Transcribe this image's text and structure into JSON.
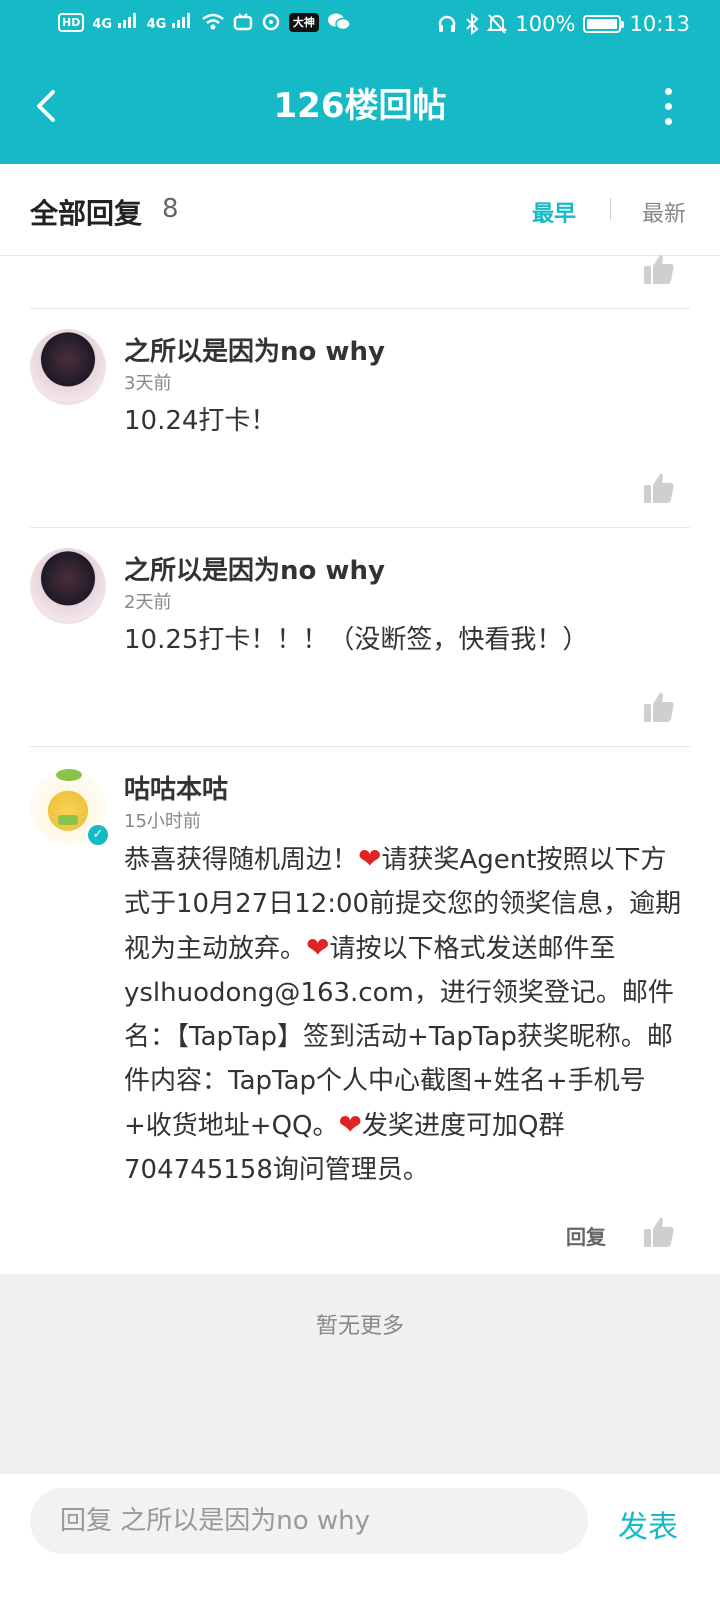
{
  "status_bar": {
    "indicators": [
      "HD",
      "4G",
      "4G"
    ],
    "app_badge": "大神",
    "battery": "100%",
    "battery_level": 1.0,
    "time": "10:13"
  },
  "title_bar": {
    "title": "126楼回帖"
  },
  "section": {
    "title": "全部回复",
    "count": "8",
    "sort_earliest": "最早",
    "sort_newest": "最新",
    "active_sort": "最早"
  },
  "comments": [
    {
      "username": "之所以是因为no why",
      "time": "3天前",
      "text": "10.24打卡！"
    },
    {
      "username": "之所以是因为no why",
      "time": "2天前",
      "text": "10.25打卡！！！（没断签，快看我！）"
    },
    {
      "username": "咕咕本咕",
      "time": "15小时前",
      "verified": true,
      "text_parts": [
        "恭喜获得随机周边！",
        "请获奖Agent按照以下方式于10月27日12:00前提交您的领奖信息，逾期视为主动放弃。",
        "请按以下格式发送邮件至yslhuodong@163.com，进行领奖登记。邮件名：【TapTap】签到活动+TapTap获奖昵称。邮件内容：TapTap个人中心截图+姓名+手机号+收货地址+QQ。",
        "发奖进度可加Q群704745158询问管理员。"
      ],
      "reply_label": "回复"
    }
  ],
  "no_more": "暂无更多",
  "bottom_bar": {
    "placeholder": "回复 之所以是因为no why",
    "publish": "发表"
  },
  "colors": {
    "accent": "#16b9c6",
    "heart": "#e02424"
  },
  "icons": {
    "back": "back-arrow-icon",
    "more": "more-vertical-icon",
    "like": "thumbs-up-icon",
    "heart": "heart-icon"
  }
}
